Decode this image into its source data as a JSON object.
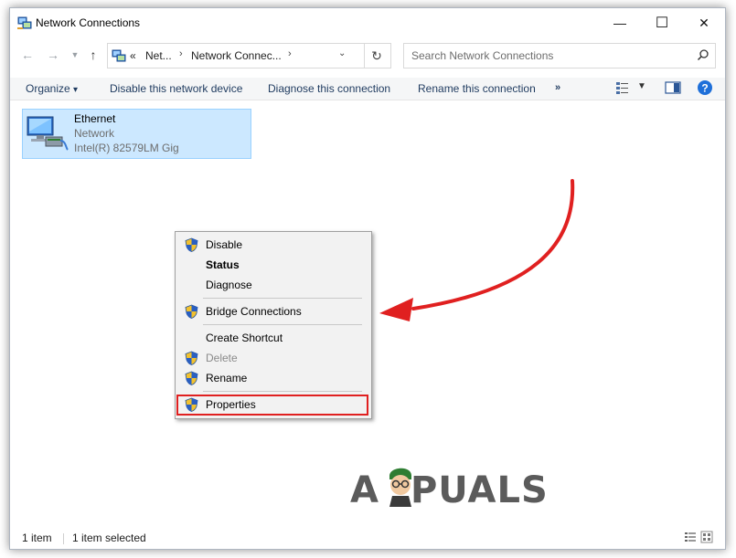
{
  "window": {
    "title": "Network Connections",
    "min_symbol": "—",
    "max_symbol": "☐",
    "close_symbol": "✕"
  },
  "address": {
    "overflow": "«",
    "crumbs": [
      "Net...",
      "Network Connec..."
    ],
    "sep": "›",
    "dropdown": "⌄",
    "refresh": "↻"
  },
  "search": {
    "placeholder": "Search Network Connections"
  },
  "toolbar": {
    "organize": "Organize",
    "organize_caret": "▾",
    "disable": "Disable this network device",
    "diagnose": "Diagnose this connection",
    "rename": "Rename this connection",
    "more": "»"
  },
  "item": {
    "name": "Ethernet",
    "type": "Network",
    "adapter": "Intel(R) 82579LM Gig"
  },
  "context_menu": {
    "items": [
      {
        "label": "Disable",
        "shield": true
      },
      {
        "label": "Status",
        "bold": true
      },
      {
        "label": "Diagnose"
      },
      {
        "label": "Bridge Connections",
        "shield": true
      },
      {
        "label": "Create Shortcut"
      },
      {
        "label": "Delete",
        "shield": true,
        "disabled": true
      },
      {
        "label": "Rename",
        "shield": true
      },
      {
        "label": "Properties",
        "shield": true,
        "highlighted": true
      }
    ]
  },
  "watermark": {
    "left": "A",
    "right": "PUALS"
  },
  "status": {
    "count": "1 item",
    "selected": "1 item selected"
  },
  "colors": {
    "selection": "#cce8ff",
    "highlight": "#e02020",
    "arrow": "#e02020"
  },
  "icons": [
    "network-connections-icon",
    "back-arrow-icon",
    "forward-arrow-icon",
    "up-arrow-icon",
    "refresh-icon",
    "search-icon",
    "change-view-icon",
    "preview-pane-icon",
    "help-icon",
    "uac-shield-icon",
    "ethernet-adapter-icon",
    "details-view-icon",
    "large-icons-view-icon"
  ]
}
